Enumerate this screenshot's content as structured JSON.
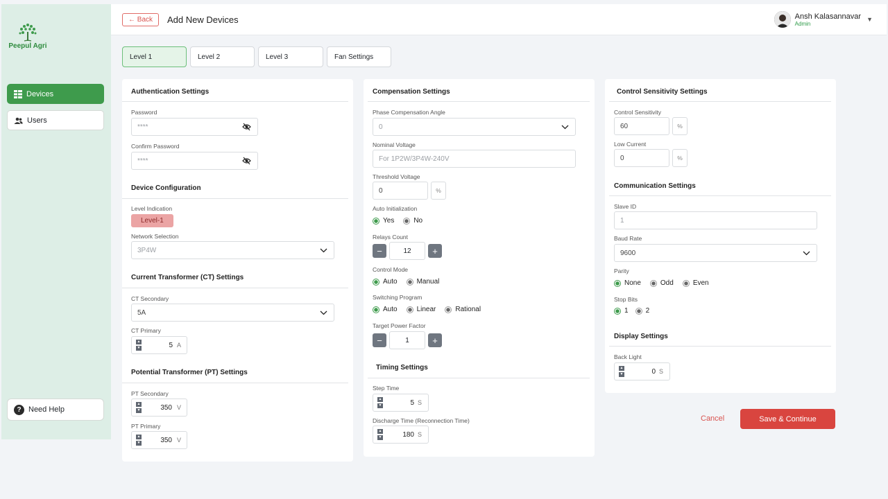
{
  "brand": {
    "name": "Peepul Agri",
    "color": "#2e8b3e"
  },
  "sidebar": {
    "items": [
      {
        "label": "Devices",
        "icon": "devices-icon",
        "active": true
      },
      {
        "label": "Users",
        "icon": "users-icon",
        "active": false
      }
    ],
    "help_label": "Need Help"
  },
  "header": {
    "back_label": "← Back",
    "title": "Add New Devices",
    "user_name": "Ansh Kalasannavar",
    "user_role": "Admin"
  },
  "tabs": [
    {
      "label": "Level 1",
      "active": true
    },
    {
      "label": "Level 2",
      "active": false
    },
    {
      "label": "Level 3",
      "active": false
    },
    {
      "label": "Fan Settings",
      "active": false
    }
  ],
  "auth": {
    "title": "Authentication Settings",
    "password_label": "Password",
    "password_value": "****",
    "confirm_label": "Confirm Password",
    "confirm_value": "****"
  },
  "device_config": {
    "title": "Device Configuration",
    "level_label": "Level Indication",
    "level_value": "Level-1",
    "network_label": "Network Selection",
    "network_value": "3P4W"
  },
  "ct": {
    "title": "Current Transformer (CT) Settings",
    "secondary_label": "CT Secondary",
    "secondary_value": "5A",
    "primary_label": "CT Primary",
    "primary_value": "5",
    "primary_unit": "A"
  },
  "pt": {
    "title": "Potential Transformer (PT) Settings",
    "secondary_label": "PT Secondary",
    "secondary_value": "350",
    "secondary_unit": "V",
    "primary_label": "PT Primary",
    "primary_value": "350",
    "primary_unit": "V"
  },
  "compensation": {
    "title": "Compensation Settings",
    "phase_label": "Phase Compensation Angle",
    "phase_value": "0",
    "nominal_label": "Nominal Voltage",
    "nominal_placeholder": "For 1P2W/3P4W-240V",
    "threshold_label": "Threshold Voltage",
    "threshold_value": "0",
    "threshold_unit": "%",
    "auto_init_label": "Auto Initialization",
    "auto_init_options": [
      "Yes",
      "No"
    ],
    "relays_label": "Relays Count",
    "relays_value": "12",
    "control_mode_label": "Control Mode",
    "control_mode_options": [
      "Auto",
      "Manual"
    ],
    "switching_label": "Switching Program",
    "switching_options": [
      "Auto",
      "Linear",
      "Rational"
    ],
    "target_pf_label": "Target Power Factor",
    "target_pf_value": "1",
    "minus": "−",
    "plus": "+"
  },
  "timing": {
    "title": "Timing Settings",
    "step_label": "Step Time",
    "step_value": "5",
    "step_unit": "S",
    "discharge_label": "Discharge Time (Reconnection Time)",
    "discharge_value": "180",
    "discharge_unit": "S"
  },
  "control_sens": {
    "title": "Control Sensitivity Settings",
    "sens_label": "Control Sensitivity",
    "sens_value": "60",
    "sens_unit": "%",
    "low_label": "Low Current",
    "low_value": "0",
    "low_unit": "%"
  },
  "communication": {
    "title": "Communication Settings",
    "slave_label": "Slave ID",
    "slave_placeholder": "1",
    "baud_label": "Baud Rate",
    "baud_value": "9600",
    "parity_label": "Parity",
    "parity_options": [
      "None",
      "Odd",
      "Even"
    ],
    "stop_label": "Stop Bits",
    "stop_options": [
      "1",
      "2"
    ]
  },
  "display": {
    "title": "Display Settings",
    "backlight_label": "Back Light",
    "backlight_value": "0",
    "backlight_unit": "S"
  },
  "actions": {
    "cancel_label": "Cancel",
    "save_label": "Save & Continue"
  },
  "colors": {
    "accent": "#3e9b4c",
    "danger": "#d9453f",
    "sidebar_bg": "#ddeee6"
  }
}
